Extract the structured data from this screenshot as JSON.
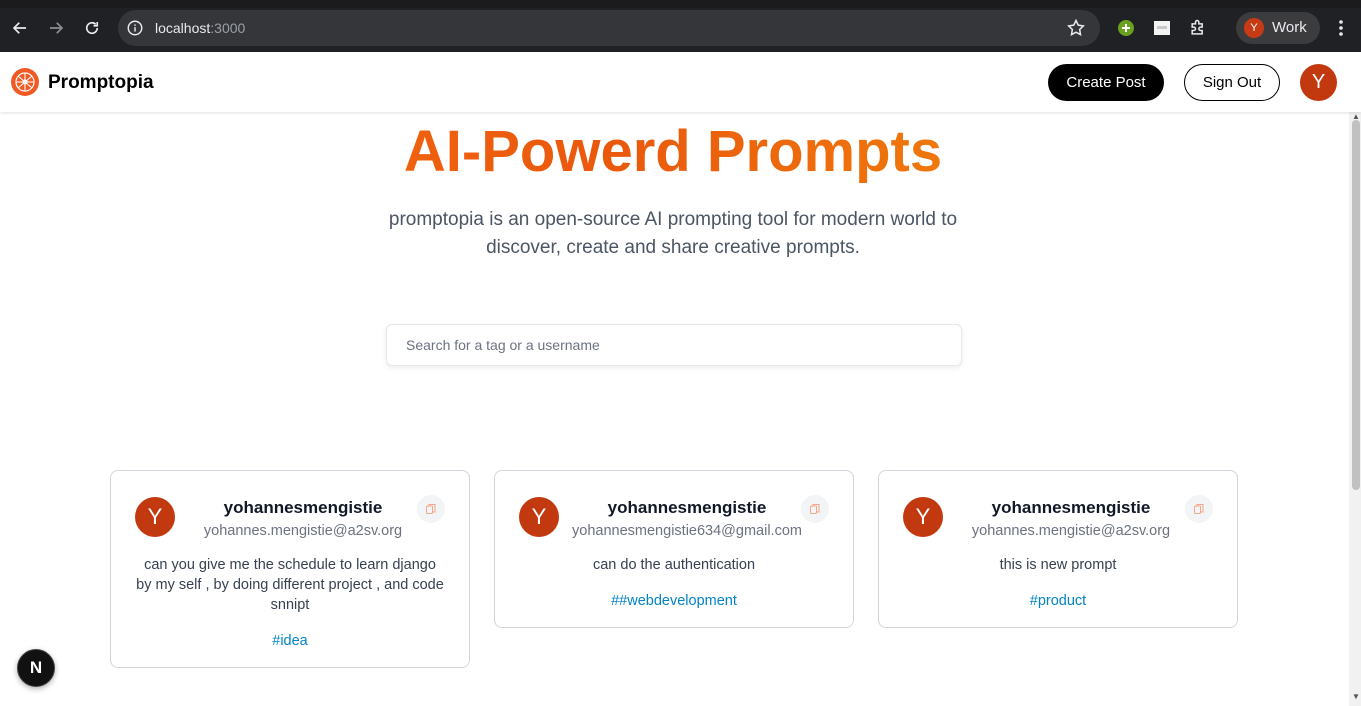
{
  "browser": {
    "url_host": "localhost",
    "url_port": ":3000",
    "profile_initial": "Y",
    "profile_label": "Work"
  },
  "nav": {
    "brand": "Promptopia",
    "create_label": "Create Post",
    "signout_label": "Sign Out",
    "avatar_initial": "Y"
  },
  "hero": {
    "title": "AI-Powerd Prompts",
    "description": "promptopia is an open-source AI prompting tool for modern world to discover, create and share creative prompts."
  },
  "search": {
    "placeholder": "Search for a tag or a username",
    "value": ""
  },
  "cards": [
    {
      "avatar_initial": "Y",
      "username": "yohannesmengistie",
      "email": "yohannes.mengistie@a2sv.org",
      "prompt": "can you give me the schedule to learn django by my self , by doing different project , and code snnipt",
      "tag": "#idea"
    },
    {
      "avatar_initial": "Y",
      "username": "yohannesmengistie",
      "email": "yohannesmengistie634@gmail.com",
      "prompt": "can do the authentication",
      "tag": "##webdevelopment"
    },
    {
      "avatar_initial": "Y",
      "username": "yohannesmengistie",
      "email": "yohannes.mengistie@a2sv.org",
      "prompt": "this is new prompt",
      "tag": "#product"
    }
  ],
  "dev_indicator": "N",
  "colors": {
    "accent_orange": "#f97316",
    "avatar_red": "#c2380f",
    "tag_blue": "#0284c7"
  }
}
